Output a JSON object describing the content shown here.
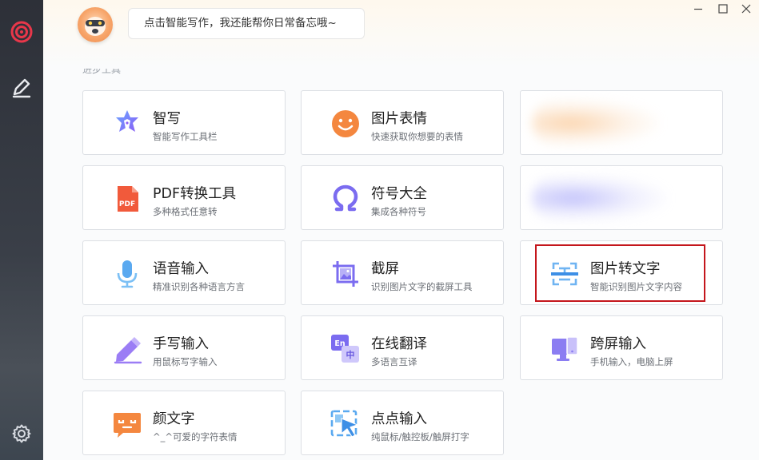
{
  "header": {
    "bubble_text": "点击智能写作，我还能帮你日常备忘哦~",
    "section_label": "进步工具"
  },
  "cards": [
    {
      "title": "智写",
      "subtitle": "智能写作工具栏",
      "icon": "star-pen-icon"
    },
    {
      "title": "图片表情",
      "subtitle": "快速获取你想要的表情",
      "icon": "smiley-icon"
    },
    {
      "title": "",
      "subtitle": "",
      "icon": "blurred-item"
    },
    {
      "title": "PDF转换工具",
      "subtitle": "多种格式任意转",
      "icon": "pdf-icon",
      "icon_text": "PDF"
    },
    {
      "title": "符号大全",
      "subtitle": "集成各种符号",
      "icon": "omega-icon"
    },
    {
      "title": "",
      "subtitle": "",
      "icon": "blurred-item"
    },
    {
      "title": "语音输入",
      "subtitle": "精准识别各种语言方言",
      "icon": "microphone-icon"
    },
    {
      "title": "截屏",
      "subtitle": "识别图片文字的截屏工具",
      "icon": "screenshot-icon"
    },
    {
      "title": "图片转文字",
      "subtitle": "智能识别图片文字内容",
      "icon": "image-to-text-icon"
    },
    {
      "title": "手写输入",
      "subtitle": "用鼠标写字输入",
      "icon": "pencil-icon"
    },
    {
      "title": "在线翻译",
      "subtitle": "多语言互译",
      "icon": "translate-icon",
      "icon_en": "En",
      "icon_zh": "中"
    },
    {
      "title": "跨屏输入",
      "subtitle": "手机输入，电脑上屏",
      "icon": "cross-screen-icon"
    },
    {
      "title": "颜文字",
      "subtitle": "^_^可爱的字符表情",
      "icon": "kaomoji-icon"
    },
    {
      "title": "点点输入",
      "subtitle": "纯鼠标/触控板/触屏打字",
      "icon": "click-input-icon"
    }
  ],
  "colors": {
    "accent_red": "#e8374a",
    "highlight": "#c4161c",
    "purple": "#7b6cf0",
    "orange": "#f08a4b",
    "blue": "#5aa9f0"
  }
}
